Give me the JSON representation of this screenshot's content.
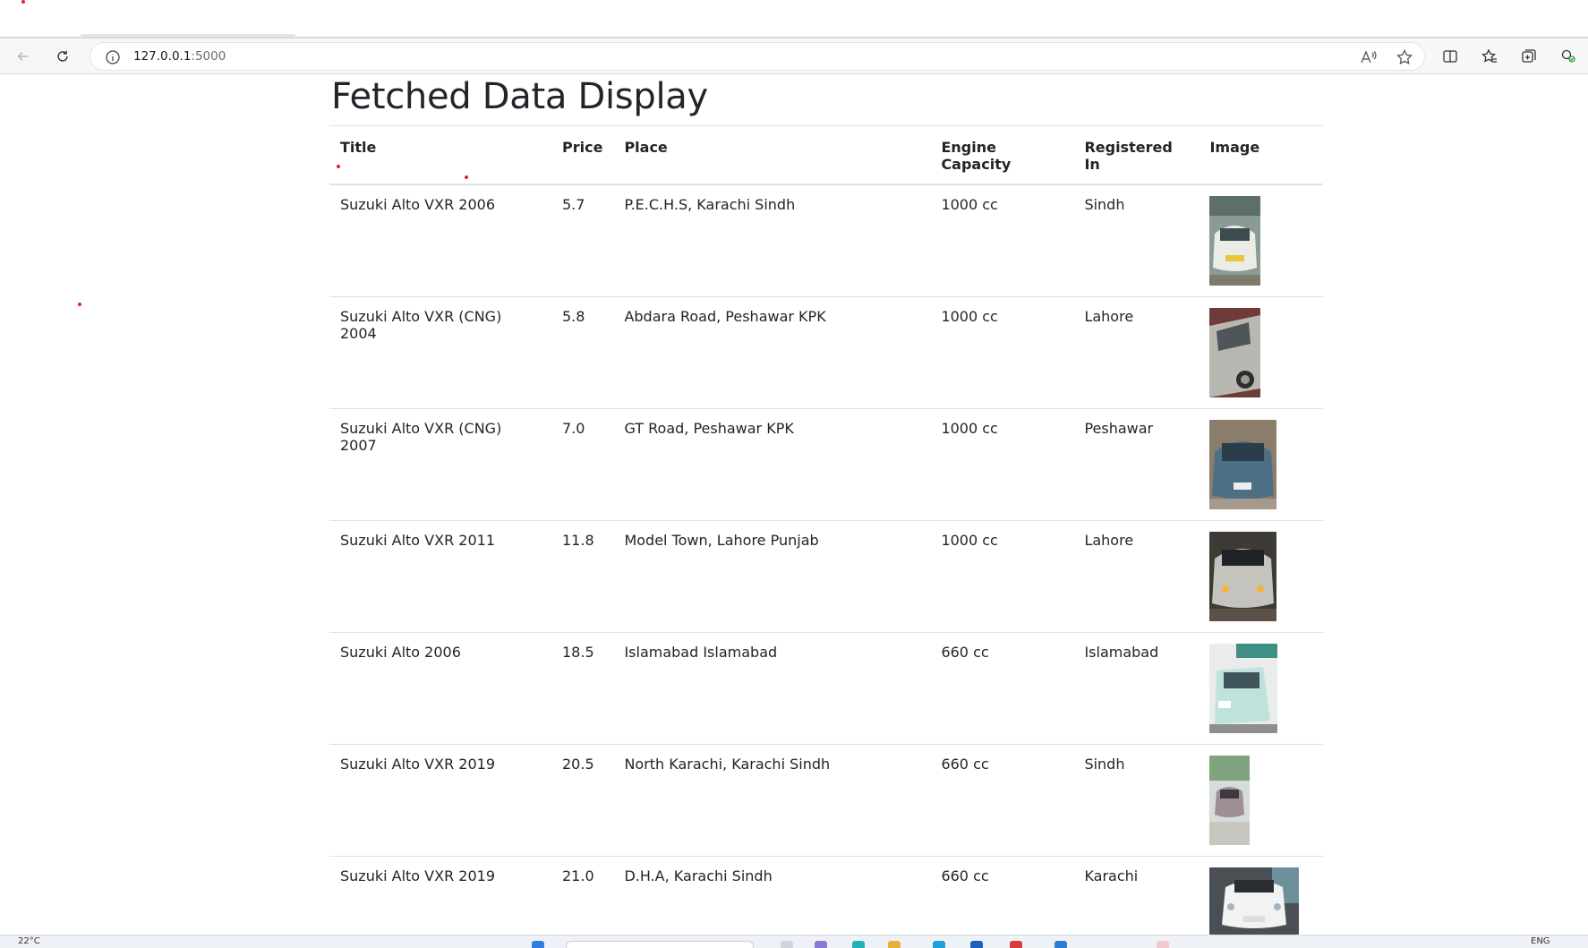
{
  "browser": {
    "url_host": "127.0.0.1",
    "url_port": ":5000"
  },
  "page": {
    "title": "Fetched Data Display"
  },
  "table": {
    "headers": {
      "title": "Title",
      "price": "Price",
      "place": "Place",
      "engine_capacity": "Engine Capacity",
      "registered_in": "Registered In",
      "image": "Image"
    },
    "rows": [
      {
        "title": "Suzuki Alto VXR 2006",
        "price": "5.7",
        "place": "P.E.C.H.S, Karachi Sindh",
        "engine_capacity": "1000 cc",
        "registered_in": "Sindh",
        "image_color": "#d9d9d2"
      },
      {
        "title": "Suzuki Alto VXR (CNG) 2004",
        "price": "5.8",
        "place": "Abdara Road, Peshawar KPK",
        "engine_capacity": "1000 cc",
        "registered_in": "Lahore",
        "image_color": "#b9b7b2"
      },
      {
        "title": "Suzuki Alto VXR (CNG) 2007",
        "price": "7.0",
        "place": "GT Road, Peshawar KPK",
        "engine_capacity": "1000 cc",
        "registered_in": "Peshawar",
        "image_color": "#4d6f86"
      },
      {
        "title": "Suzuki Alto VXR 2011",
        "price": "11.8",
        "place": "Model Town, Lahore Punjab",
        "engine_capacity": "1000 cc",
        "registered_in": "Lahore",
        "image_color": "#c5c3bd"
      },
      {
        "title": "Suzuki Alto 2006",
        "price": "18.5",
        "place": "Islamabad Islamabad",
        "engine_capacity": "660 cc",
        "registered_in": "Islamabad",
        "image_color": "#bfe3dc"
      },
      {
        "title": "Suzuki Alto VXR 2019",
        "price": "20.5",
        "place": "North Karachi, Karachi Sindh",
        "engine_capacity": "660 cc",
        "registered_in": "Sindh",
        "image_color": "#9d8f95"
      },
      {
        "title": "Suzuki Alto VXR 2019",
        "price": "21.0",
        "place": "D.H.A, Karachi Sindh",
        "engine_capacity": "660 cc",
        "registered_in": "Karachi",
        "image_color": "#f2f2f2"
      }
    ]
  },
  "taskbar": {
    "weather": "22°C",
    "language": "ENG"
  }
}
